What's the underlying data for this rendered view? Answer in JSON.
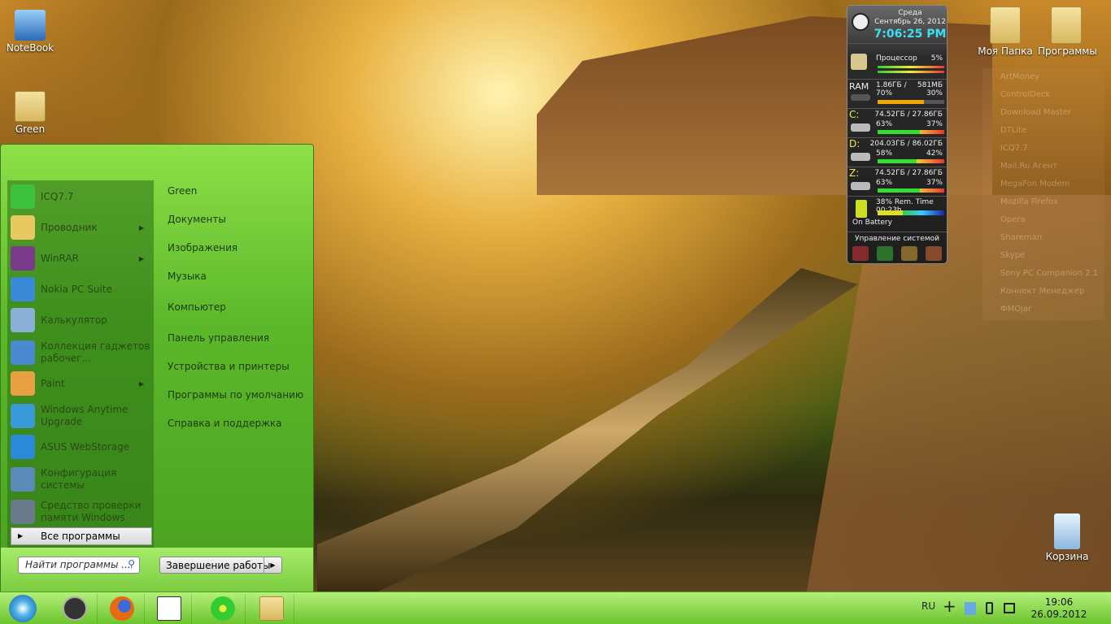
{
  "desktop": {
    "icons": [
      {
        "label": "NoteBook"
      },
      {
        "label": "Green"
      },
      {
        "label": "Моя Папка"
      },
      {
        "label": "Программы"
      },
      {
        "label": "Корзина"
      }
    ],
    "faded_list": [
      "ArtMoney",
      "ControlDeck",
      "Download Master",
      "DTLite",
      "ICQ7.7",
      "Mail.Ru Агент",
      "MegaFon Modem",
      "Mozilla Firefox",
      "Opera",
      "Shareman",
      "Skype",
      "Sony PC Companion 2.1",
      "Коннект Менеджер",
      "ФМОjar"
    ]
  },
  "start_menu": {
    "programs": [
      {
        "label": "ICQ7.7",
        "color": "#3cc23c",
        "arrow": false
      },
      {
        "label": "Проводник",
        "color": "#e8c860",
        "arrow": true
      },
      {
        "label": "WinRAR",
        "color": "#7a3a8a",
        "arrow": true
      },
      {
        "label": "Nokia PC Suite",
        "color": "#3a8ad8",
        "arrow": false
      },
      {
        "label": "Калькулятор",
        "color": "#8ab0d8",
        "arrow": false
      },
      {
        "label": "Коллекция гаджетов рабочег...",
        "color": "#4a8ad0",
        "arrow": false
      },
      {
        "label": "Paint",
        "color": "#e8a040",
        "arrow": true
      },
      {
        "label": "Windows Anytime Upgrade",
        "color": "#3a9ad8",
        "arrow": false
      },
      {
        "label": "ASUS WebStorage",
        "color": "#2a8ad8",
        "arrow": false
      },
      {
        "label": "Конфигурация системы",
        "color": "#5a8ab8",
        "arrow": false
      },
      {
        "label": "Средство проверки памяти Windows",
        "color": "#6a7a8a",
        "arrow": false
      }
    ],
    "all_programs": "Все программы",
    "places": [
      "Green",
      "Документы",
      "Изображения",
      "Музыка",
      "Компьютер",
      "Панель управления",
      "Устройства и принтеры",
      "Программы по умолчанию",
      "Справка и поддержка"
    ],
    "search_placeholder": "Найти программы ...",
    "shutdown": "Завершение работы"
  },
  "taskbar": {
    "pinned": [
      "start-orb",
      "counter-strike",
      "firefox",
      "1000-cards",
      "icq",
      "explorer"
    ],
    "lang": "RU",
    "time": "19:06",
    "date": "26.09.2012"
  },
  "gadget": {
    "day": "Среда",
    "date": "Сентябрь 26, 2012",
    "time": "7:06:25 PM",
    "cpu": {
      "label": "Процессор",
      "percent": "5%",
      "value": 5
    },
    "ram": {
      "label": "RAM",
      "used": "1.86ГБ /",
      "free": "581МБ",
      "used_pct": "70%",
      "free_pct": "30%",
      "value": 70
    },
    "drives": [
      {
        "letter": "C:",
        "size": "74.52ГБ / 27.86ГБ",
        "used": "63%",
        "free": "37%",
        "value": 63
      },
      {
        "letter": "D:",
        "size": "204.03ГБ / 86.02ГБ",
        "used": "58%",
        "free": "42%",
        "value": 58
      },
      {
        "letter": "Z:",
        "size": "74.52ГБ / 27.86ГБ",
        "used": "63%",
        "free": "37%",
        "value": 63
      }
    ],
    "battery": {
      "text": "38% Rem. Time 00:23h",
      "status": "On Battery",
      "value": 38
    },
    "system_label": "Управление системой"
  }
}
